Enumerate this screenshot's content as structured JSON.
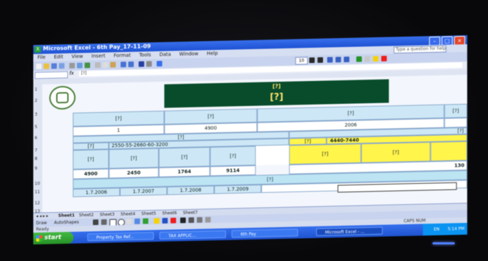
{
  "window": {
    "title": "Microsoft Excel - 6th Pay_17-11-09"
  },
  "menu": {
    "items": [
      "File",
      "Edit",
      "View",
      "Insert",
      "Format",
      "Tools",
      "Data",
      "Window",
      "Help"
    ],
    "help_placeholder": "Type a question for help"
  },
  "toolbar": {
    "font_size": "10"
  },
  "formula_bar": {
    "name_box": "",
    "content": "[?]"
  },
  "sheet": {
    "banner_line1": "[?]",
    "banner_line2": "[?]",
    "row4": {
      "a": "[?]",
      "b": "[?]",
      "c": "[?]",
      "d": "[?]"
    },
    "row6": {
      "a": "1",
      "b": "4900",
      "c": "2006"
    },
    "header7": "[?]",
    "right7": "[?]",
    "row8": {
      "a": "[?]",
      "b": "2550-55-2660-60-3200",
      "c": "[?]",
      "d": "4440-7440"
    },
    "row9": {
      "a": "[?]",
      "b": "[?]",
      "c": "[?]",
      "d": "[?]",
      "e": "[?]",
      "f": "[?]"
    },
    "row11": {
      "a": "4900",
      "b": "2450",
      "c": "1764",
      "d": "9114",
      "e": "130"
    },
    "row12": "[?]",
    "dates": [
      "1.7.2006",
      "1.7.2007",
      "1.7.2008",
      "1.7.2009"
    ]
  },
  "sheet_tabs": [
    "Sheet1",
    "Sheet2",
    "Sheet3",
    "Sheet4",
    "Sheet5",
    "Sheet6",
    "Sheet7"
  ],
  "draw_bar": {
    "draw": "Draw",
    "autoshapes": "AutoShapes"
  },
  "status": {
    "left": "Ready",
    "right": "CAPS NUM"
  },
  "taskbar": {
    "start": "start",
    "buttons": [
      "Property Tax Ref...",
      "TAX APPLIC...",
      "6th Pay",
      "Microsoft Excel - ..."
    ],
    "clock": "5:14 PM",
    "lang": "EN"
  }
}
